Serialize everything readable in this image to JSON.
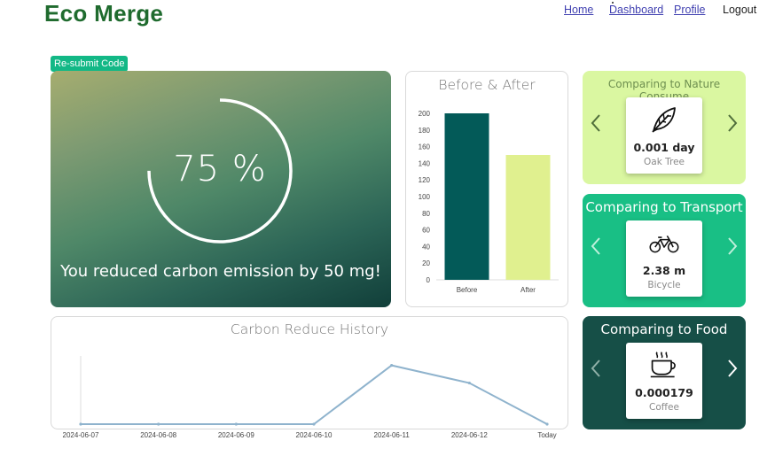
{
  "header": {
    "brand": "Eco Merge",
    "nav": [
      {
        "label": "Home"
      },
      {
        "label": "Dashboard"
      },
      {
        "label": "Profile"
      },
      {
        "label": "Logout"
      }
    ]
  },
  "resubmit_label": "Re-submit Code",
  "hero": {
    "percent_text": "75 %",
    "progress": 0.75,
    "message": "You reduced carbon emission by 50 mg!"
  },
  "before_after": {
    "title": "Before & After"
  },
  "history": {
    "title": "Carbon Reduce History"
  },
  "comparisons": [
    {
      "title": "Comparing to Nature Consume",
      "value": "0.001 day",
      "label": "Oak Tree",
      "icon": "leaf-icon"
    },
    {
      "title": "Comparing to Transport",
      "value": "2.38 m",
      "label": "Bicycle",
      "icon": "bicycle-icon"
    },
    {
      "title": "Comparing to Food",
      "value": "0.000179",
      "label": "Coffee",
      "icon": "coffee-cup-icon"
    }
  ],
  "colors": {
    "brand": "#1f6b2e",
    "accent": "#12b886",
    "bar_before": "#035a58",
    "bar_after": "#e0f08f",
    "line": "#8fb3cd"
  },
  "chart_data": [
    {
      "type": "bar",
      "title": "Before & After",
      "categories": [
        "Before",
        "After"
      ],
      "values": [
        200,
        150
      ],
      "ylim": [
        0,
        200
      ],
      "yticks": [
        0,
        20,
        40,
        60,
        80,
        100,
        120,
        140,
        160,
        180,
        200
      ]
    },
    {
      "type": "line",
      "title": "Carbon Reduce History",
      "x": [
        "2024-06-07",
        "2024-06-08",
        "2024-06-09",
        "2024-06-10",
        "2024-06-11",
        "2024-06-12",
        "Today"
      ],
      "values": [
        0,
        0,
        0,
        0,
        50,
        35,
        0
      ],
      "ylim": [
        0,
        55
      ]
    }
  ]
}
